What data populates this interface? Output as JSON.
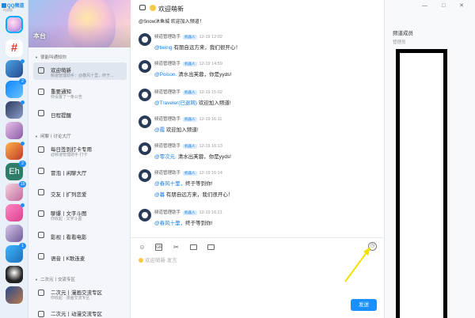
{
  "app": {
    "logo": "QQ频道",
    "sub": "内测版"
  },
  "rail": {
    "badges": {
      "g4": "2",
      "g5": "",
      "g8": "2",
      "g9": "19",
      "g11": "",
      "g12": "1"
    }
  },
  "guild": {
    "name": "本台"
  },
  "sections": {
    "s1": "很能叫通知你",
    "s2": "闲聊丨讨论大厅",
    "s3": "二次元丨交流专区"
  },
  "channels": [
    {
      "name": "欢迎萌新",
      "sub": "频道管理助手：@春风十里，终于...",
      "selected": true
    },
    {
      "name": "重要通知",
      "sub": "你设置了一条公告"
    },
    {
      "name": "日程提醒",
      "sub": ""
    },
    {
      "name": "每日签到打卡专用",
      "sub": "@频道管理助手 打卡"
    },
    {
      "name": "冒泡丨闲聊大厅",
      "sub": ""
    },
    {
      "name": "交友丨扩列恋爱",
      "sub": ""
    },
    {
      "name": "聊爆丨文字斗图",
      "sub": "你收起 · 文字斗图"
    },
    {
      "name": "影视丨看看电影",
      "sub": ""
    },
    {
      "name": "语音丨K歌连麦",
      "sub": ""
    },
    {
      "name": "二次元丨漫画交流专区",
      "sub": "你收起 · 漫画交流专区"
    },
    {
      "name": "二次元丨动漫交流专区",
      "sub": ""
    }
  ],
  "chat": {
    "title": "欢迎萌新",
    "top_note": "@Snow沐鱼城 欢迎加入频道！",
    "messages": [
      {
        "sender": "频道管理助手",
        "tag": "机器人",
        "time": "12-19 12:02",
        "mention": "@being",
        "text": " 有朋自远方来，我们很开心！"
      },
      {
        "sender": "频道管理助手",
        "tag": "机器人",
        "time": "12-19 14:59",
        "mention": "@Poison.",
        "text": " 清水出芙蓉，你是yyds!"
      },
      {
        "sender": "频道管理助手",
        "tag": "机器人",
        "time": "12-19 15:02",
        "mention": "@Traveler(已退网)",
        "text": " 欢迎加入频道!"
      },
      {
        "sender": "频道管理助手",
        "tag": "机器人",
        "time": "12-19 16:11",
        "mention": "@霞",
        "text": " 欢迎加入频道!"
      },
      {
        "sender": "频道管理助手",
        "tag": "机器人",
        "time": "12-19 16:13",
        "mention": "@零次元.",
        "text": " 清水出芙蓉，你是yyds!"
      },
      {
        "sender": "频道管理助手",
        "tag": "机器人",
        "time": "12-19 16:14",
        "mention": "@春风十里，",
        "text": "终于等到你!",
        "mention2": "@暮",
        "text2": " 有朋自远方来，我们很开心！"
      },
      {
        "sender": "频道管理助手",
        "tag": "机器人",
        "time": "12-19 16:21",
        "mention": "@春风十里，",
        "text": "终于等到你!"
      }
    ]
  },
  "composer": {
    "placeholder": "欢迎萌新 发言",
    "send": "发送",
    "tools": [
      "smile-icon",
      "gif-icon",
      "scissors-icon",
      "folder-icon",
      "screen-icon"
    ],
    "history": "◷"
  },
  "members": {
    "title": "频道成员",
    "sub": "管理员",
    "controls": "— □ ✕"
  },
  "colors": {
    "accent": "#1890ff",
    "mention": "#1a7ee0",
    "annotation": "#f5e000"
  }
}
